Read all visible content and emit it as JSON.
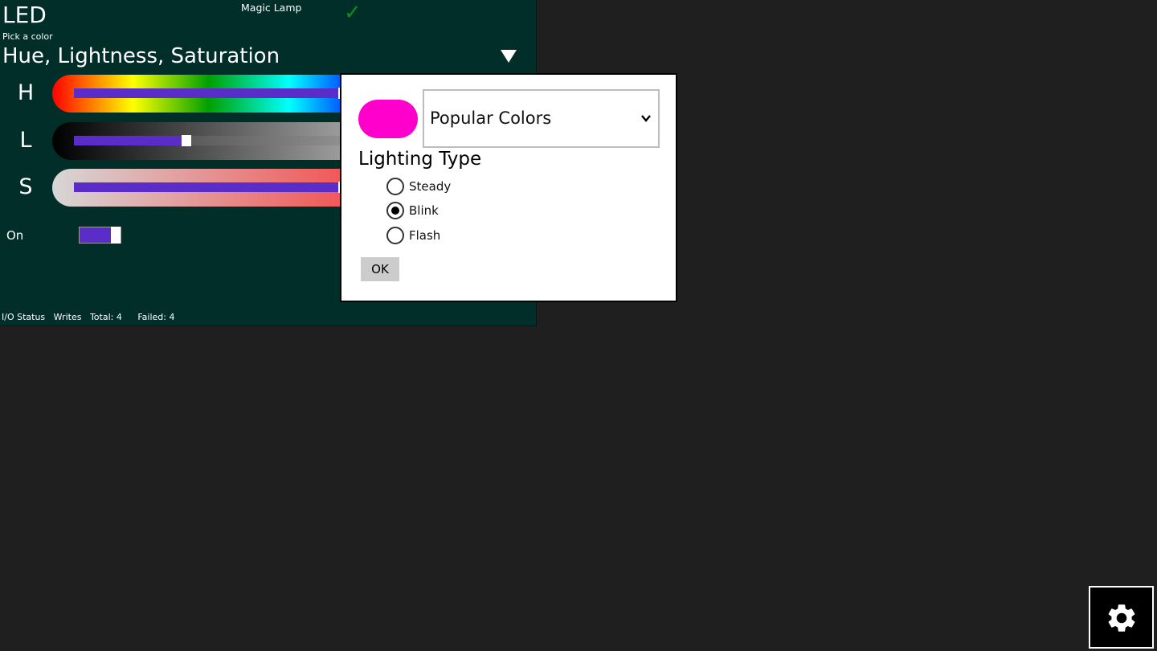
{
  "header": {
    "title": "LED",
    "device_name": "Magic Lamp",
    "subtitle": "Pick a color",
    "mode": "Hue, Lightness, Saturation"
  },
  "sliders": [
    {
      "letter": "H",
      "value": 0.62
    },
    {
      "letter": "L",
      "value": 0.26
    },
    {
      "letter": "S",
      "value": 0.62
    }
  ],
  "power": {
    "label": "On",
    "on": true
  },
  "status_bar": {
    "io": "I/O Status",
    "writes": "Writes",
    "total": "Total: 4",
    "failed": "Failed: 4"
  },
  "dialog": {
    "swatch_color": "#ff00cc",
    "preset_select": "Popular Colors",
    "lighting_title": "Lighting Type",
    "options": [
      {
        "label": "Steady",
        "selected": false
      },
      {
        "label": "Blink",
        "selected": true
      },
      {
        "label": "Flash",
        "selected": false
      }
    ],
    "ok_label": "OK"
  },
  "colors": {
    "panel_background": "#022e2a",
    "app_background": "#1f1f1f",
    "accent": "#5a2dc8",
    "check": "#128a1e"
  },
  "icons": {
    "mode_dropdown": "triangle-down-icon",
    "status": "check-icon",
    "preset_select": "chevron-down-icon",
    "settings": "gear-icon"
  }
}
